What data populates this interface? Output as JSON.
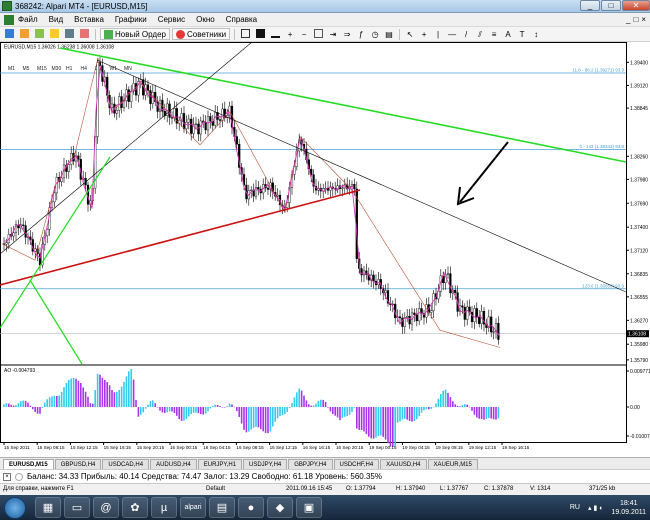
{
  "window": {
    "title": "368242: Alpari MT4 - [EURUSD,M15]",
    "min": "_",
    "max": "□",
    "close": "✕"
  },
  "menu": {
    "items": [
      "Файл",
      "Вид",
      "Вставка",
      "Графики",
      "Сервис",
      "Окно",
      "Справка"
    ],
    "mdi_controls": [
      "_",
      "□",
      "×"
    ]
  },
  "toolbar": {
    "new_order": "Новый Ордер",
    "advisors": "Советники"
  },
  "timeframes": [
    "M1",
    "M5",
    "M15",
    "M30",
    "H1",
    "H4",
    "D1",
    "W1",
    "MN"
  ],
  "chart": {
    "header": "EURUSD,M15 1.36026 1.36238 1.36008 1.36108",
    "price_axis": [
      "1.39400",
      "1.39120",
      "1.38845",
      "1.38260",
      "1.37980",
      "1.37690",
      "1.37400",
      "1.37120",
      "1.36835",
      "1.36555",
      "1.36270",
      "1.35980",
      "1.35790"
    ],
    "price_top": 1.3955,
    "price_bottom": 1.3574,
    "fib_lines": [
      {
        "label": "11.8 - 88.2 (1.39271) 93.9",
        "price": 1.39271
      },
      {
        "label": "0 - 143 (1.38343) 93.9",
        "price": 1.38343
      },
      {
        "label": "123.6 (1.36653) 93.9",
        "price": 1.36653
      }
    ],
    "current_price": "1.36108",
    "current_price_value": 1.36108,
    "time_axis": [
      "15 Sep 2011",
      "15 Sep 08:15",
      "15 Sep 12:15",
      "15 Sep 16:15",
      "15 Sep 20:15",
      "16 Sep 00:15",
      "16 Sep 04:15",
      "16 Sep 08:15",
      "16 Sep 12:15",
      "16 Sep 16:15",
      "16 Sep 20:15",
      "19 Sep 00:15",
      "19 Sep 04:15",
      "19 Sep 08:15",
      "19 Sep 12:15",
      "19 Sep 16:15"
    ],
    "indicator_label": "AO -0.004793",
    "indicator_axis": [
      "0.009771",
      "0.00",
      "-0.01007"
    ],
    "colors": {
      "bull": "#000000",
      "bear": "#000000",
      "trend_green": "#22dd22",
      "trend_red": "#cc1111",
      "fib_blue": "#4aa0d8",
      "ao_up": "#33ccee",
      "ao_down": "#aa33ee"
    }
  },
  "tabs": [
    "EURUSD,M15",
    "GBPUSD,H4",
    "USDCAD,H4",
    "AUDUSD,H4",
    "EURJPY,H1",
    "USDJPY,H4",
    "GBPJPY,H4",
    "USDCHF,H4",
    "XAUUSD,H4",
    "XAUEUR,M15"
  ],
  "account": {
    "text": "Баланс: 34.33  Прибыль: 40.14  Средства: 74.47  Залог: 13.29  Свободно: 61.18  Уровень: 560.35%"
  },
  "status": {
    "help": "Для справки, нажмите F1",
    "profile": "Default",
    "time": "2011.09.16 15:45",
    "open": "O: 1.37794",
    "high": "H: 1.37940",
    "low": "L: 1.37767",
    "close": "C: 1.37878",
    "volume": "V: 1314",
    "traffic": "371/25 kb"
  },
  "taskbar": {
    "lang": "RU",
    "time": "18:41",
    "date": "19.09.2011"
  }
}
